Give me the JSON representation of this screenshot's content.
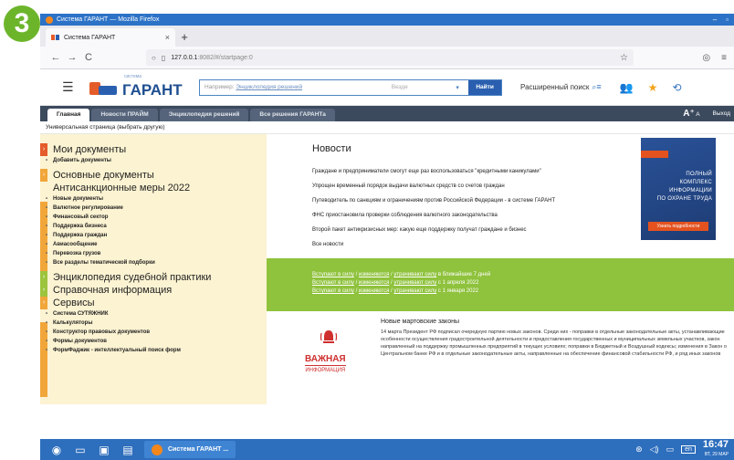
{
  "step_badge": "3",
  "window": {
    "title": "Система ГАРАНТ — Mozilla Firefox"
  },
  "browser": {
    "tab_title": "Система ГАРАНТ",
    "url_host": "127.0.0.1",
    "url_path": ":8082/#/startpage:0"
  },
  "header": {
    "logo_small": "система",
    "logo_text": "ГАРАНТ",
    "search_placeholder_prefix": "Например:",
    "search_placeholder_link": "Энциклопедия решений",
    "search_scope": "Везде",
    "search_button": "Найти",
    "advanced_search": "Расширенный поиск"
  },
  "nav_tabs": [
    "Главная",
    "Новости ПРАЙМ",
    "Энциклопедия решений",
    "Все решения ГАРАНТа"
  ],
  "font_controls": {
    "larger": "A⁺",
    "smaller": "A"
  },
  "logout": "Выход",
  "universal_page": "Универсальная страница (выбрать другую)",
  "sidebar": {
    "my_docs": {
      "title": "Мои документы",
      "items": [
        "Добавить документы"
      ]
    },
    "basic_docs": {
      "title": "Основные документы"
    },
    "anti_sanctions": {
      "title": "Антисанкционные меры 2022",
      "items": [
        "Новые документы",
        "Валютное регулирование",
        "Финансовый сектор",
        "Поддержка бизнеса",
        "Поддержка граждан",
        "Авиасообщение",
        "Перевозка грузов",
        "Все разделы тематической подборки"
      ]
    },
    "encyclopedia": {
      "title": "Энциклопедия судебной практики"
    },
    "reference": {
      "title": "Справочная информация"
    },
    "services": {
      "title": "Сервисы",
      "items": [
        "Система СУТЯЖНИК",
        "Калькуляторы",
        "Конструктор правовых документов",
        "Формы документов",
        "ФормФаджик - интеллектуальный поиск форм"
      ]
    }
  },
  "news": {
    "title": "Новости",
    "items": [
      "Граждане и предприниматели смогут еще раз воспользоваться \"кредитными каникулами\"",
      "Упрощен временный порядок выдачи валютных средств со счетов граждан",
      "Путеводитель по санкциям и ограничениям против Российской Федерации - в системе ГАРАНТ",
      "ФНС приостановила проверки соблюдения валютного законодательства",
      "Второй пакет антикризисных мер: какую еще поддержку получат граждане и бизнес",
      "Все новости"
    ]
  },
  "promo": {
    "lines": [
      "ПОЛНЫЙ",
      "КОМПЛЕКС",
      "ИНФОРМАЦИИ",
      "ПО ОХРАНЕ ТРУДА"
    ],
    "button": "Узнать подробности"
  },
  "changes": {
    "link1": "Вступают в силу",
    "link2": "изменяются",
    "link3": "утрачивают силу",
    "rows": [
      "в ближайшие 7 дней",
      "с 1 апреля 2022",
      "с 1 января 2022"
    ]
  },
  "laws": {
    "label_big": "ВАЖНАЯ",
    "label_small": "ИНФОРМАЦИЯ",
    "title": "Новые мартовские законы",
    "text": "14 марта Президент РФ подписал очередную партию новых законов. Среди них - поправки в отдельные законодательные акты, устанавливающие особенности осуществления градостроительной деятельности и предоставления государственных и муниципальных земельных участков, закон направленный на поддержку промышленных предприятий в текущих условиях; поправки в Бюджетный и Воздушный кодексы; изменения в Закон о Центральном банке РФ и в отдельные законодательные акты, направленные на обеспечение финансовой стабильности РФ, и ряд иных законов"
  },
  "taskbar": {
    "app": "Система ГАРАНТ ...",
    "lang": "en",
    "time": "16:47",
    "date": "ВТ, 29 МАР"
  },
  "colors": {
    "firefox_title": "#2c72c7",
    "garant_blue": "#1f4f91",
    "nav_dark": "#3c4a5e",
    "green_banner": "#8fc23d",
    "sidebar_bg": "#fcf3d2",
    "accent_red": "#e45c2a",
    "badge_green": "#6cb52b"
  }
}
